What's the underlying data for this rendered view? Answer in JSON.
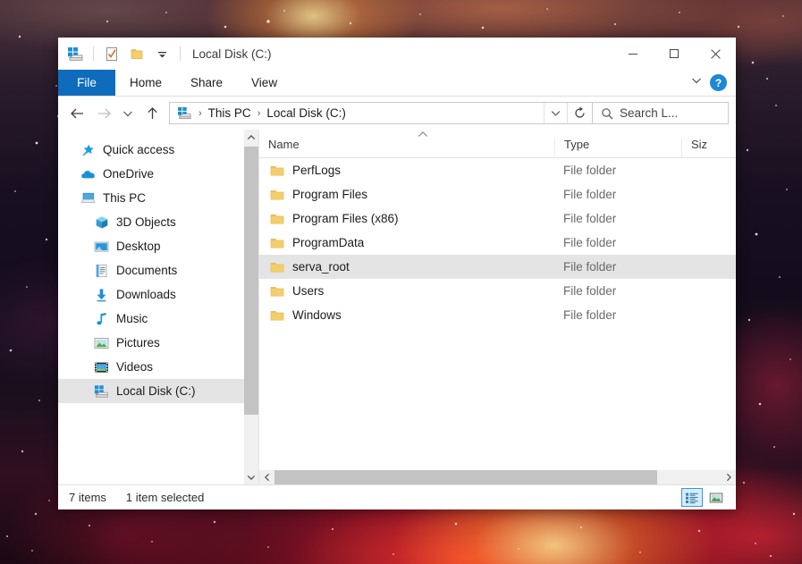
{
  "window": {
    "title": "Local Disk (C:)",
    "quick_access_icons": [
      "explorer-drive-icon",
      "properties-icon",
      "new-folder-icon",
      "customize-qat-chevron-icon"
    ],
    "controls": {
      "minimize": "minimize-icon",
      "maximize": "maximize-icon",
      "close": "close-icon"
    }
  },
  "ribbon": {
    "tabs": [
      {
        "label": "File",
        "active": true
      },
      {
        "label": "Home",
        "active": false
      },
      {
        "label": "Share",
        "active": false
      },
      {
        "label": "View",
        "active": false
      }
    ],
    "collapse_icon": "chevron-down-icon",
    "help_label": "?"
  },
  "address": {
    "back_icon": "back-arrow-icon",
    "forward_icon": "forward-arrow-icon",
    "recent_icon": "chevron-down-icon",
    "up_icon": "up-arrow-icon",
    "drive_icon": "local-disk-icon",
    "crumbs": [
      "This PC",
      "Local Disk (C:)"
    ],
    "separator": "›",
    "dropdown_icon": "chevron-down-icon",
    "refresh_icon": "refresh-icon"
  },
  "search": {
    "icon": "search-icon",
    "placeholder": "Search L..."
  },
  "sidebar": {
    "items": [
      {
        "label": "Quick access",
        "icon": "star-pin-icon",
        "indent": false,
        "selected": false
      },
      {
        "label": "OneDrive",
        "icon": "cloud-icon",
        "indent": false,
        "selected": false
      },
      {
        "label": "This PC",
        "icon": "this-pc-icon",
        "indent": false,
        "selected": false
      },
      {
        "label": "3D Objects",
        "icon": "cube-icon",
        "indent": true,
        "selected": false
      },
      {
        "label": "Desktop",
        "icon": "desktop-icon",
        "indent": true,
        "selected": false
      },
      {
        "label": "Documents",
        "icon": "documents-icon",
        "indent": true,
        "selected": false
      },
      {
        "label": "Downloads",
        "icon": "downloads-icon",
        "indent": true,
        "selected": false
      },
      {
        "label": "Music",
        "icon": "music-note-icon",
        "indent": true,
        "selected": false
      },
      {
        "label": "Pictures",
        "icon": "pictures-icon",
        "indent": true,
        "selected": false
      },
      {
        "label": "Videos",
        "icon": "videos-icon",
        "indent": true,
        "selected": false
      },
      {
        "label": "Local Disk (C:)",
        "icon": "local-disk-icon",
        "indent": true,
        "selected": true
      }
    ],
    "scrollbar": {
      "up_icon": "scroll-up-icon",
      "down_icon": "scroll-down-icon"
    }
  },
  "filelist": {
    "sort_indicator": "sort-ascending-caret",
    "columns": [
      {
        "key": "name",
        "label": "Name"
      },
      {
        "key": "type",
        "label": "Type"
      },
      {
        "key": "size",
        "label": "Siz"
      }
    ],
    "rows": [
      {
        "name": "PerfLogs",
        "type": "File folder",
        "size": "",
        "selected": false,
        "icon": "folder-icon"
      },
      {
        "name": "Program Files",
        "type": "File folder",
        "size": "",
        "selected": false,
        "icon": "folder-icon"
      },
      {
        "name": "Program Files (x86)",
        "type": "File folder",
        "size": "",
        "selected": false,
        "icon": "folder-icon"
      },
      {
        "name": "ProgramData",
        "type": "File folder",
        "size": "",
        "selected": false,
        "icon": "folder-icon"
      },
      {
        "name": "serva_root",
        "type": "File folder",
        "size": "",
        "selected": true,
        "icon": "folder-icon"
      },
      {
        "name": "Users",
        "type": "File folder",
        "size": "",
        "selected": false,
        "icon": "folder-icon"
      },
      {
        "name": "Windows",
        "type": "File folder",
        "size": "",
        "selected": false,
        "icon": "folder-icon"
      }
    ],
    "hscrollbar": {
      "left_icon": "scroll-left-icon",
      "right_icon": "scroll-right-icon"
    }
  },
  "statusbar": {
    "item_count": "7 items",
    "selection": "1 item selected",
    "views": [
      {
        "name": "details-view",
        "active": true
      },
      {
        "name": "large-icons-view",
        "active": false
      }
    ]
  }
}
